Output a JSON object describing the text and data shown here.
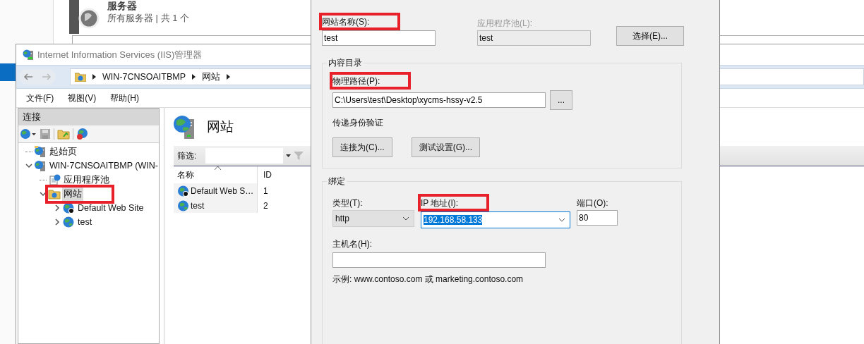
{
  "background_window": {
    "title": "服务器",
    "subtitle": "所有服务器 | 共 1 个"
  },
  "iis": {
    "title": "Internet Information Services (IIS)管理器",
    "breadcrumb": [
      "WIN-7CNSOAITBMP",
      "网站"
    ],
    "menu": [
      "文件(F)",
      "视图(V)",
      "帮助(H)"
    ],
    "connections": {
      "title": "连接",
      "tree": [
        {
          "label": "起始页",
          "kind": "start",
          "selected": false,
          "highlighted": false
        },
        {
          "label": "WIN-7CNSOAITBMP (WIN-",
          "kind": "server",
          "expanded": true,
          "selected": false,
          "highlighted": false,
          "children": [
            {
              "label": "应用程序池",
              "kind": "pool",
              "selected": false,
              "highlighted": false
            },
            {
              "label": "网站",
              "kind": "folder",
              "expanded": true,
              "selected": true,
              "highlighted": true,
              "children": [
                {
                  "label": "Default Web Site",
                  "kind": "site-stopped",
                  "expanded": false,
                  "selected": false,
                  "highlighted": false
                },
                {
                  "label": "test",
                  "kind": "site",
                  "expanded": false,
                  "selected": false,
                  "highlighted": false
                }
              ]
            }
          ]
        }
      ]
    },
    "content": {
      "title": "网站",
      "filter_label": "筛选:",
      "columns": [
        "名称",
        "ID"
      ],
      "rows": [
        {
          "name": "Default Web S…",
          "id": "1",
          "kind": "site-stopped"
        },
        {
          "name": "test",
          "id": "2",
          "kind": "site"
        }
      ]
    }
  },
  "dialog": {
    "site_name": {
      "label": "网站名称(S):",
      "value": "test",
      "highlighted": true
    },
    "app_pool": {
      "label": "应用程序池(L):",
      "value": "test",
      "disabled": true,
      "highlighted": false
    },
    "select_button": "选择(E)...",
    "content_directory": {
      "title": "内容目录",
      "physical_path": {
        "label": "物理路径(P):",
        "value": "C:\\Users\\test\\Desktop\\xycms-hssy-v2.5",
        "highlighted": true
      },
      "browse_button": "...",
      "pass_through_label": "传递身份验证",
      "buttons": [
        "连接为(C)...",
        "测试设置(G)..."
      ]
    },
    "binding": {
      "title": "绑定",
      "type": {
        "label": "类型(T):",
        "value": "http",
        "highlighted": false
      },
      "ip_address": {
        "label": "IP 地址(I):",
        "value": "192.168.58.133",
        "focused": true,
        "highlighted": true
      },
      "port": {
        "label": "端口(O):",
        "value": "80",
        "highlighted": false
      },
      "host_name": {
        "label": "主机名(H):",
        "highlighted": false
      },
      "example": "示例: www.contoso.com 或 marketing.contoso.com"
    }
  }
}
